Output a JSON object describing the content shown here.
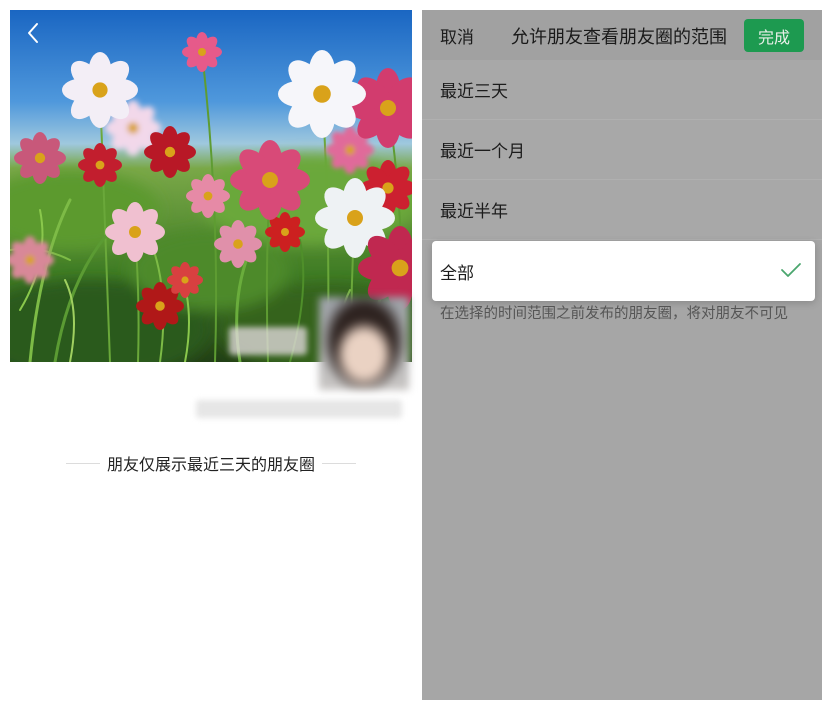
{
  "left_panel": {
    "back_icon": "chevron-left-icon",
    "footer_text": "朋友仅展示最近三天的朋友圈"
  },
  "right_panel": {
    "header": {
      "cancel_label": "取消",
      "title": "允许朋友查看朋友圈的范围",
      "done_label": "完成"
    },
    "options": [
      {
        "label": "最近三天",
        "selected": false
      },
      {
        "label": "最近一个月",
        "selected": false
      },
      {
        "label": "最近半年",
        "selected": false
      },
      {
        "label": "全部",
        "selected": true
      }
    ],
    "check_icon": "checkmark-icon",
    "footnote": "在选择的时间范围之前发布的朋友圈，将对朋友不可见"
  },
  "colors": {
    "accent": "#1d9a50",
    "overlay_gray": "#a6a6a6",
    "selected_bg": "#ffffff",
    "checkmark": "#4aa66e"
  }
}
